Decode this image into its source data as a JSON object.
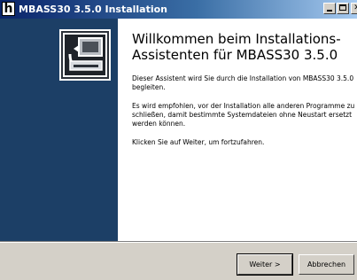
{
  "window": {
    "app_icon_letter": "h",
    "title": "MBASS30 3.5.0 Installation"
  },
  "main": {
    "heading": "Willkommen beim Installations-Assistenten für MBASS30 3.5.0",
    "paragraphs": [
      "Dieser Assistent wird Sie durch die Installation von MBASS30 3.5.0 begleiten.",
      "Es wird empfohlen, vor der Installation alle anderen Programme zu schließen, damit bestimmte Systemdateien ohne Neustart ersetzt werden können.",
      "Klicken Sie auf Weiter, um fortzufahren."
    ]
  },
  "buttons": {
    "next_label": "Weiter >",
    "cancel_label": "Abbrechen"
  },
  "colors": {
    "sidebar": "#1c3f66",
    "titlebar": "#0a246a",
    "dialog": "#d4d0c8"
  },
  "icons": [
    "installer-logo-icon",
    "minimize-icon",
    "maximize-icon",
    "close-icon"
  ]
}
